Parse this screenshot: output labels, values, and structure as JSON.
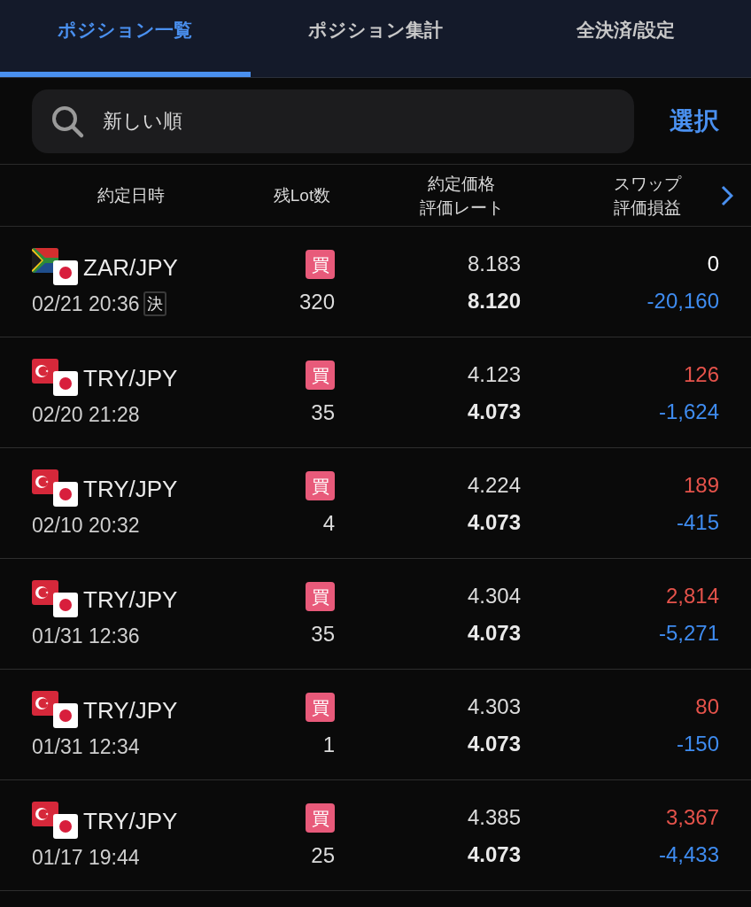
{
  "tabs": [
    {
      "label": "ポジション一覧",
      "selected": true
    },
    {
      "label": "ポジション集計",
      "selected": false
    },
    {
      "label": "全決済/設定",
      "selected": false
    }
  ],
  "sort_field": {
    "value": "新しい順"
  },
  "select_button": "選択",
  "columns": [
    {
      "lines": [
        "約定日時"
      ]
    },
    {
      "lines": [
        "残Lot数"
      ]
    },
    {
      "lines": [
        "約定価格",
        "評価レート"
      ]
    },
    {
      "lines": [
        "スワップ",
        "評価損益"
      ]
    }
  ],
  "rows": [
    {
      "kind": "za",
      "pair": "ZAR/JPY",
      "datetime": "02/21 20:36",
      "settle_badge": "決",
      "side": "買",
      "lots": "320",
      "price": "8.183",
      "rate": "8.120",
      "swap": "0",
      "color": "#ffffff",
      "pnl": "-20,160"
    },
    {
      "kind": "tr",
      "pair": "TRY/JPY",
      "datetime": "02/20 21:28",
      "side": "買",
      "lots": "35",
      "price": "4.123",
      "rate": "4.073",
      "swap": "126",
      "color": "#e5534b",
      "pnl": "-1,624"
    },
    {
      "kind": "tr",
      "pair": "TRY/JPY",
      "datetime": "02/10 20:32",
      "side": "買",
      "lots": "4",
      "price": "4.224",
      "rate": "4.073",
      "swap": "189",
      "color": "#e5534b",
      "pnl": "-415"
    },
    {
      "kind": "tr",
      "pair": "TRY/JPY",
      "datetime": "01/31 12:36",
      "side": "買",
      "lots": "35",
      "price": "4.304",
      "rate": "4.073",
      "swap": "2,814",
      "color": "#e5534b",
      "pnl": "-5,271"
    },
    {
      "kind": "tr",
      "pair": "TRY/JPY",
      "datetime": "01/31 12:34",
      "side": "買",
      "lots": "1",
      "price": "4.303",
      "rate": "4.073",
      "swap": "80",
      "color": "#e5534b",
      "pnl": "-150"
    },
    {
      "kind": "tr",
      "pair": "TRY/JPY",
      "datetime": "01/17 19:44",
      "side": "買",
      "lots": "25",
      "price": "4.385",
      "rate": "4.073",
      "swap": "3,367",
      "color": "#e5534b",
      "pnl": "-4,433"
    }
  ]
}
